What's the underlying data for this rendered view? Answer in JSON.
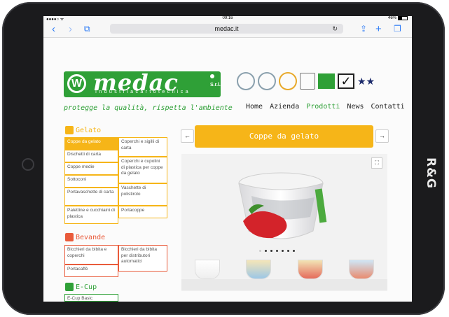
{
  "device": {
    "brand": "R&G"
  },
  "status_bar": {
    "signal": "●●●●○ ᯤ",
    "time": "09:16",
    "battery": "46%"
  },
  "browser": {
    "url": "medac.it"
  },
  "header": {
    "logo_name": "medac",
    "logo_sub": "Industriacartotecnica",
    "logo_suffix": "S.r.l.",
    "tagline": "protegge la qualità, rispetta l'ambiente",
    "nav": [
      "Home",
      "Azienda",
      "Prodotti",
      "News",
      "Contatti"
    ],
    "stars": "★★"
  },
  "categories": [
    {
      "title": "Gelato",
      "color": "#f6b518"
    },
    {
      "title": "Bevande",
      "color": "#e95b3b"
    },
    {
      "title": "E-Cup",
      "color": "#2fa037"
    }
  ],
  "gelato_items_left": [
    "Coppe da gelato",
    "Dischetti di carta",
    "Coppe medie",
    "Sottoconi",
    "Portavaschette di carta",
    "Palettine e cucchiaini di plastica"
  ],
  "gelato_items_right": [
    "Coperchi e sigilli di carta",
    "Coperchi e cupolini di plastica per coppe da gelato",
    "Vaschette di polistirolo",
    "Portacoppe"
  ],
  "bevande_items_left": [
    "Bicchieri da bibita e coperchi",
    "Portacaffè"
  ],
  "bevande_items_right": [
    "Bicchieri da bibita per distributori automatici"
  ],
  "ecup_items": [
    "E-Cup Basic"
  ],
  "product": {
    "title": "Coppe da gelato",
    "prev": "←",
    "next": "→",
    "expand": "⛶"
  }
}
